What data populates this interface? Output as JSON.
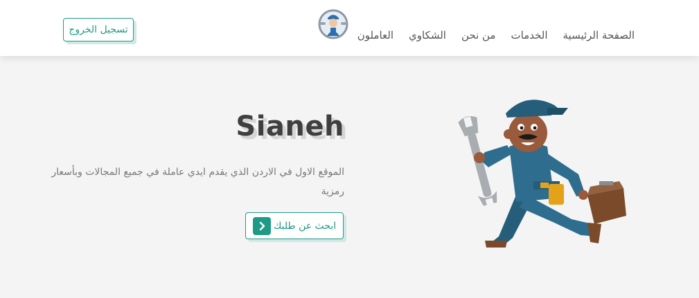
{
  "navbar": {
    "links": [
      {
        "label": "الصفحة الرئيسية"
      },
      {
        "label": "الخدمات"
      },
      {
        "label": "من نحن"
      },
      {
        "label": "الشكاوي"
      },
      {
        "label": "العاملون"
      }
    ],
    "logout_label": "تسجيل الخروج",
    "logo_icon": "mechanic-logo-icon"
  },
  "hero": {
    "title": "Sianeh",
    "description": "الموقع الاول في الاردن الذي يقدم ايدي عاملة في جميع المجالات وبأسعار رمزية",
    "search_label": "ابحث عن طلبك",
    "search_icon": "chevron-left-icon",
    "illustration": "worker-with-wrench-and-toolbox"
  },
  "colors": {
    "accent": "#1f9a86",
    "background": "#f4f4f4",
    "navbar": "#ffffff",
    "title": "#3f3f3f",
    "text": "#777777"
  }
}
